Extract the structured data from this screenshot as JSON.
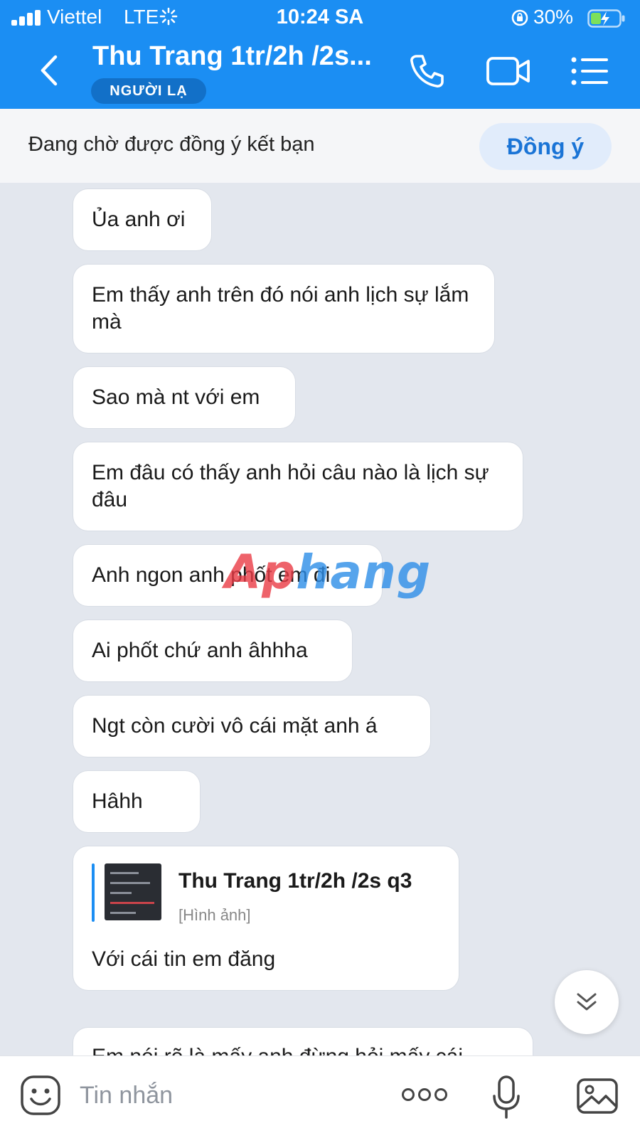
{
  "status_bar": {
    "carrier": "Viettel",
    "network": "LTE",
    "time": "10:24 SA",
    "battery": "30%"
  },
  "header": {
    "title": "Thu Trang 1tr/2h /2s...",
    "badge": "NGƯỜI LẠ",
    "accent_color": "#1b8ef3"
  },
  "pending": {
    "text": "Đang chờ được đồng ý kết bạn",
    "accept_label": "Đồng ý"
  },
  "messages": [
    {
      "text": "Ủa anh ơi"
    },
    {
      "text": "Em thấy anh trên đó nói anh lịch sự lắm mà"
    },
    {
      "text": "Sao mà nt với em"
    },
    {
      "text": "Em đâu có thấy anh hỏi câu nào là lịch sự đâu"
    },
    {
      "text": "Anh ngon anh phốt em đi"
    },
    {
      "text": "Ai phốt chứ anh âhhha"
    },
    {
      "text": "Ngt còn cười vô cái mặt anh á"
    },
    {
      "text": "Hâhh"
    },
    {
      "quote": {
        "name": "Thu Trang 1tr/2h /2s  q3",
        "type": "[Hình ảnh]"
      },
      "text": "Với cái tin em đăng"
    },
    {
      "text": "Em nói rõ là mấy anh đừng hỏi mấy cái"
    }
  ],
  "watermark": {
    "part1": "Ap",
    "part2": "hang"
  },
  "composer": {
    "placeholder": "Tin nhắn"
  },
  "icons": [
    "back-icon",
    "call-icon",
    "video-call-icon",
    "menu-icon",
    "emoji-icon",
    "more-icon",
    "mic-icon",
    "image-icon",
    "chevron-double-down-icon"
  ]
}
